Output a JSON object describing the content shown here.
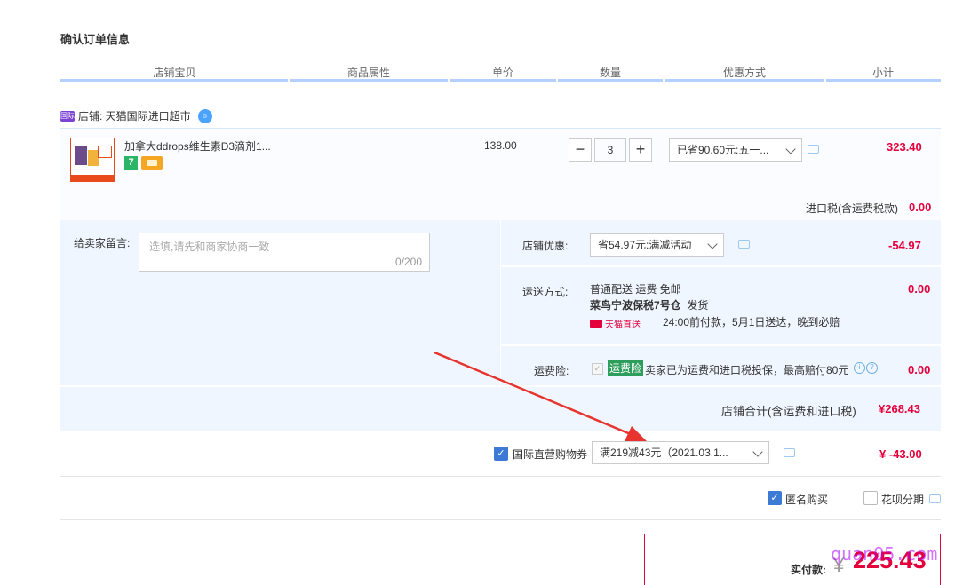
{
  "title": "确认订单信息",
  "columns": [
    "店铺宝贝",
    "商品属性",
    "单价",
    "数量",
    "优惠方式",
    "小计"
  ],
  "shop": {
    "badge": "国际",
    "label": "店铺: 天猫国际进口超市"
  },
  "item": {
    "name": "加拿大ddrops维生素D3滴剂1...",
    "icon7": "7",
    "price": "138.00",
    "qty_minus": "−",
    "qty": "3",
    "qty_plus": "+",
    "discount_select": "已省90.60元:五一...",
    "subtotal": "323.40",
    "tax_label": "进口税(含运费税款)",
    "tax_value": "0.00"
  },
  "note": {
    "label": "给卖家留言:",
    "placeholder": "选填,请先和商家协商一致",
    "counter": "0/200"
  },
  "store_discount": {
    "label": "店铺优惠:",
    "select": "省54.97元:满减活动",
    "amount": "-54.97"
  },
  "shipping": {
    "label": "运送方式:",
    "line1": "普通配送 运费 免邮",
    "line2_bold": "菜鸟宁波保税7号仓",
    "line2_rest": "发货",
    "tmall_brand": "天猫直送",
    "promise": "24:00前付款，5月1日送达，晚到必赔",
    "amount": "0.00"
  },
  "insurance": {
    "label": "运费险:",
    "tag": "运费险",
    "text": "卖家已为运费和进口税投保，最高赔付80元",
    "amount": "0.00"
  },
  "store_total": {
    "label": "店铺合计(含运费和进口税)",
    "amount": "¥268.43"
  },
  "coupon": {
    "label": "国际直营购物券",
    "select": "满219减43元（2021.03.1...",
    "amount": "¥ -43.00"
  },
  "options": {
    "anonymous": "匿名购买",
    "installment": "花呗分期"
  },
  "payment": {
    "label": "实付款:",
    "currency": "¥",
    "amount": "225.43",
    "watermark": "quan05.com"
  },
  "colors": {
    "accent": "#e4003a",
    "blue": "#3d7ad5",
    "panel": "#f0f6ff"
  }
}
